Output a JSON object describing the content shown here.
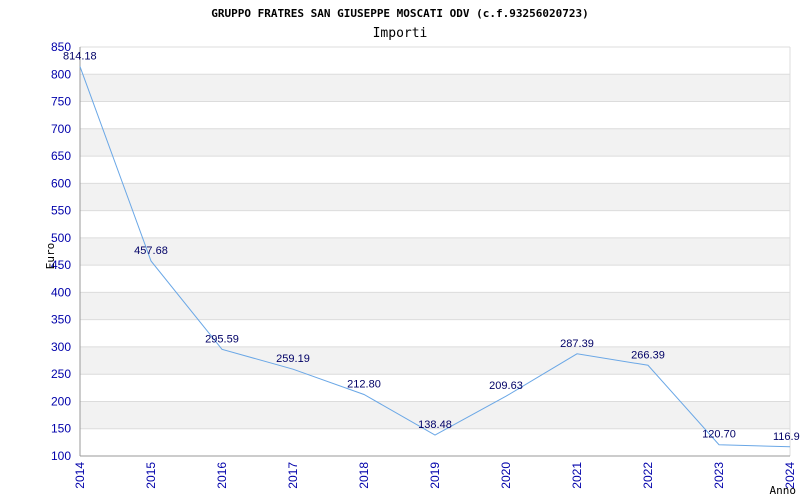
{
  "chart_data": {
    "type": "line",
    "title": "GRUPPO FRATRES SAN GIUSEPPE MOSCATI ODV (c.f.93256020723)",
    "subtitle": "Importi",
    "xlabel": "Anno",
    "ylabel": "Euro",
    "categories": [
      "2014",
      "2015",
      "2016",
      "2017",
      "2018",
      "2019",
      "2020",
      "2021",
      "2022",
      "2023",
      "2024"
    ],
    "values": [
      814.18,
      457.68,
      295.59,
      259.19,
      212.8,
      138.48,
      209.63,
      287.39,
      266.39,
      120.7,
      116.9
    ],
    "value_labels": [
      "814.18",
      "457.68",
      "295.59",
      "259.19",
      "212.80",
      "138.48",
      "209.63",
      "287.39",
      "266.39",
      "120.70",
      "116.90"
    ],
    "ylim": [
      100,
      850
    ],
    "yticks": [
      100,
      150,
      200,
      250,
      300,
      350,
      400,
      450,
      500,
      550,
      600,
      650,
      700,
      750,
      800,
      850
    ],
    "grid": true,
    "line_color": "#6aa7e6",
    "band_color": "#f2f2f2",
    "grid_color": "#dcdcdc",
    "tick_color": "#0000aa"
  }
}
